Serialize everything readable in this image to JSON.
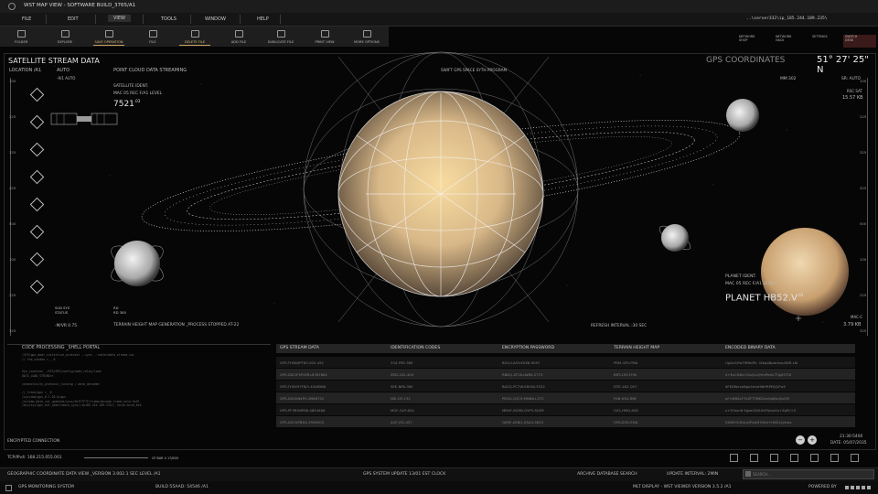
{
  "window": {
    "title": "WST MAP VIEW - SOFTWARE BUILD_3765/A1"
  },
  "menu": {
    "items": [
      "FILE",
      "EDIT",
      "VIEW",
      "TOOLS",
      "WINDOW",
      "HELP"
    ],
    "active": "VIEW",
    "address": "..\\server332\\ip_185.244.189.235\\"
  },
  "toolbar": {
    "buttons": [
      "FOLDER",
      "EXPLORE",
      "SAVE OPERATION",
      "FILE",
      "DELETE FILE",
      "ADD FILE",
      "DUBLICATE FILE",
      "PRINT VIEW",
      "MORE OPTIONS"
    ],
    "highlighted": [
      "SAVE OPERATION",
      "DELETE FILE"
    ]
  },
  "right_tools": [
    [
      "NETWORK",
      "SHOP"
    ],
    [
      "NETWORK",
      "HACK"
    ],
    [
      "SETTINGS",
      ""
    ],
    [
      "SWITCH",
      "DESK"
    ]
  ],
  "left_panel": {
    "title": "SATELLITE STREAM DATA",
    "location": "LOCATION /A1",
    "auto": "AUTO",
    "sub": "-9/1 AUTO",
    "point_cloud": "POINT CLOUD DATA STREAMING",
    "sat_ident": "SATELLITE IDENT.",
    "mac": "MAC 05 REC F/A1 LEVEL",
    "sat_value": "7521",
    "sat_exp": ".03",
    "subsys": "SUB SYS",
    "status": "STATUS",
    "rd": "RD",
    "rd_value": "RD 380",
    "mvr": "-M/VR 0.75",
    "terrain_msg": "TERRAIN HEIGHT MAP GENERATION _PROCESS STOPPED AT-22"
  },
  "center": {
    "swift": "SWIFT GPS SPACE SYTH PROGRAM",
    "refresh": "REFRESH INTERVAL :30 SEC"
  },
  "right_panel": {
    "title": "GPS COORDINATES",
    "coords": "51° 27' 25\" N",
    "mm": "MM:302",
    "sr": "SR: AUTO",
    "rsc_sat": "RSC SAT",
    "rsc_kb": "15.57 KB",
    "planet_ident": "PLANET IDENT.",
    "planet_mac": "MAC 05 REC F/A1 LEVEL",
    "planet_name": "PLANET HB52.V",
    "planet_exp": ".03",
    "mac_c": "MAC-C",
    "mac_kb": "3.79 KB"
  },
  "ruler_left": [
    "100",
    "",
    "225",
    "",
    "325",
    "",
    "425",
    "",
    "500",
    "",
    "100",
    "",
    "225",
    "",
    "325",
    "",
    "425",
    "",
    "500",
    "",
    "100",
    "",
    "225",
    "",
    "325",
    "",
    "425",
    "",
    "500"
  ],
  "ruler_right": [
    "100",
    "",
    "225",
    "",
    "325",
    "",
    "425",
    "",
    "500",
    "",
    "100",
    "",
    "225",
    "",
    "325",
    "",
    "425",
    "",
    "500",
    "",
    "100",
    "",
    "225",
    "",
    "325",
    "",
    "425",
    "",
    "500"
  ],
  "code_panel": {
    "title": "CODE PROCESSING _SHELL PORTAL",
    "lines": [
      "/SYS/gps_mod>_initialize_protocol --sync --route=data_stream.ini",
      "// the_window >__ 0",
      "",
      "",
      "Sys_location_ /SYS/GPS/config/node_relay/load",
      "DATA_LOAD_STRING>>",
      "",
      "connectivity_protocol_running / data_decoded",
      "",
      "//_trace/gps >__0",
      "/sys/mod/gps_6.1.20.0/gps",
      "/stream_data_int_updated/sync/0x7F7F7F/frame/decode_frame_hold 0x91",
      "/bin/sys/gps_ext_ident/data_sync//ip185.244.189.235//_route.bind_0x4"
    ],
    "encrypted": "ENCRYPTED CONNECTION",
    "tcp": "TCP/IPv4: 168.215.055.001",
    "cp": "CP BAR V 17/800"
  },
  "table": {
    "headers": [
      "GPS STREAM DATA",
      "IDENTIFICATION CODES",
      "ENCRYPTION PASSWORD",
      "TERRAIN HEIGHT MAP",
      "ENCODED BINARY DATA"
    ],
    "rows": [
      [
        "GPS-TH58XPT63-003-452",
        "334-FRE-389",
        "BX2J-LA5Y-K9Z8-9097",
        "PRM-435-PMA",
        "UgAcGHa7fRNdPh- IXbq48pbrAsq4WR-L6l"
      ],
      [
        "GPS-DXCIFXP2SRI-6787862",
        "SRD-202-404",
        "RBDQ-XF2K-LW8X-2775",
        "BRT-293-FHN",
        "0+EuC9BcrCXs/ts1/HmPeXsTTlg5OTl0"
      ],
      [
        "GPS-TH5X97F6J3-4548586",
        "SEE-NPA-360",
        "BA2Q-PC7W-E8GW-3322",
        "DTE-162-QFC",
        "dFEDWcsnBgx4moHWrIRPE8j1Fw5"
      ],
      [
        "GPS-DX2KN4PO-8986752",
        "NSI-GP-132",
        "PM20-Q3C9-MNB6-L372",
        "FKB-HS4-RNF",
        "pf+WRAcF7kZFTTBK0GaQqBtuQoCM"
      ],
      [
        "GPS-PF3R5NPSB-5854466",
        "MGF-GLP-624",
        "M8HF-9G9D-GYP3-SH2R",
        "OZL-HMQ-ASE",
        "s+3Yw/n6 SgdsCB4UlnPI/eiaOs+ZpPi/+Z"
      ],
      [
        "GPS-DX2XPBD4-3946003",
        "AUF-J92-457",
        "QKRF-ASBQ-D5A4-5623",
        "GYK-DSD-SMA",
        "KXNFrGrEbJ-d/P/bk9YVKe+HNCs4ykwv"
      ]
    ]
  },
  "bottom_right": {
    "time": "21:30:5400",
    "date": "DATE: 05/07/2035"
  },
  "statusbar": {
    "left": "GEOGRAPHIC COORDINATE DATA VIEW _VERSION 3.002.1 SEC LEVEL /A1",
    "center": "GPS SYSTEM UPDATE 13/01 EST CLOCK",
    "archive": "ARCHIVE DATABASE SEARCH",
    "interval": "UPDATE INTERVAL: 2MIN",
    "search_placeholder": "SEARCH..."
  },
  "footer": {
    "left": "GPS MONITORING SYSTEM",
    "build": "BUILD 55AAD: 54546 /A1",
    "right": "MLT DISPLAY - WST VIEWER VERSION 3.5.2 /A1",
    "powered": "POWERED BY"
  },
  "colors": {
    "accent": "#c9a05a",
    "planet": "#e6c89a",
    "bg": "#060606"
  }
}
